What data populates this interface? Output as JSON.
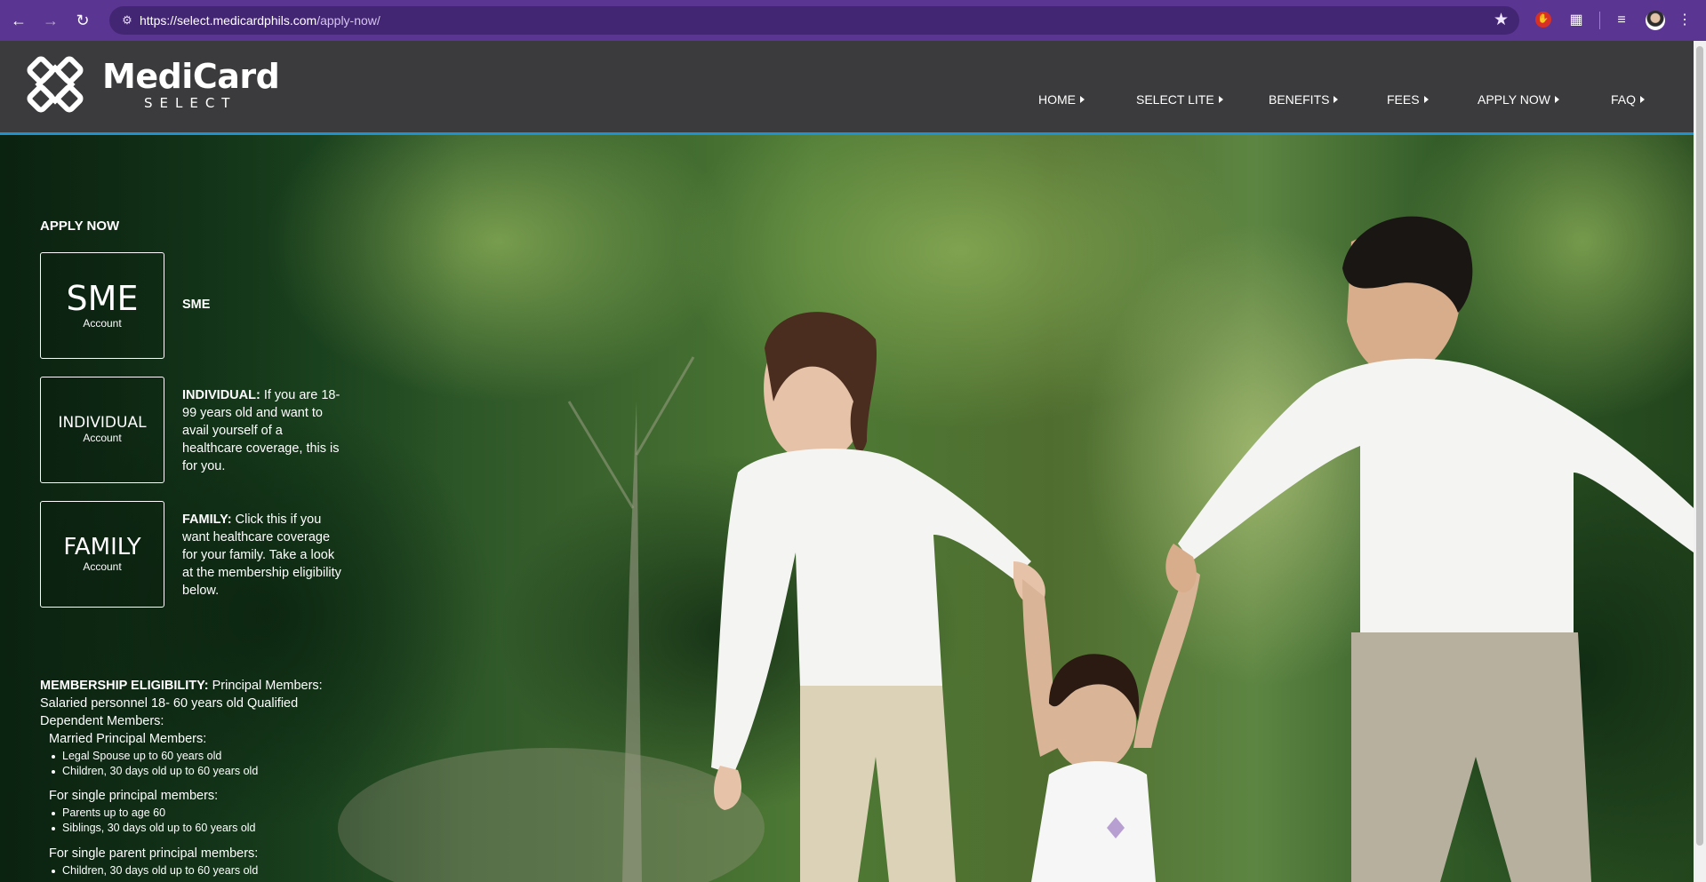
{
  "browser": {
    "url_host": "https://select.medicardphils.com",
    "url_path": "/apply-now/"
  },
  "site": {
    "logo_title": "MediCard",
    "logo_subtitle": "SELECT"
  },
  "nav": {
    "items": [
      {
        "label": "HOME"
      },
      {
        "label": "SELECT LITE"
      },
      {
        "label": "BENEFITS"
      },
      {
        "label": "FEES"
      },
      {
        "label": "APPLY NOW"
      },
      {
        "label": "FAQ"
      }
    ]
  },
  "apply": {
    "title": "APPLY NOW",
    "accounts": [
      {
        "name": "SME",
        "sub": "Account",
        "desc_title": "SME",
        "desc_body": ""
      },
      {
        "name": "INDIVIDUAL",
        "sub": "Account",
        "desc_title": "INDIVIDUAL:",
        "desc_body": " If you are 18-99 years old and want to avail yourself of a healthcare coverage, this is for you."
      },
      {
        "name": "FAMILY",
        "sub": "Account",
        "desc_title": "FAMILY:",
        "desc_body": " Click this if you want healthcare coverage for your family. Take a look at the membership eligibility below."
      }
    ]
  },
  "eligibility": {
    "title": "MEMBERSHIP ELIGIBILITY:",
    "intro": " Principal Members: Salaried personnel 18- 60 years old Qualified Dependent Members:",
    "groups": [
      {
        "title": "Married Principal Members:",
        "items": [
          "Legal Spouse up to 60 years old",
          "Children, 30 days old up to 60 years old"
        ]
      },
      {
        "title": "For single principal members:",
        "items": [
          "Parents up to age 60",
          "Siblings, 30 days old up to 60 years old"
        ]
      },
      {
        "title": "For single parent principal members:",
        "items": [
          "Children, 30 days old up to 60 years old"
        ]
      }
    ]
  },
  "colors": {
    "browser_chrome": "#5a3591",
    "header_bg": "#3b3b3d",
    "header_accent": "#1f93cf"
  }
}
